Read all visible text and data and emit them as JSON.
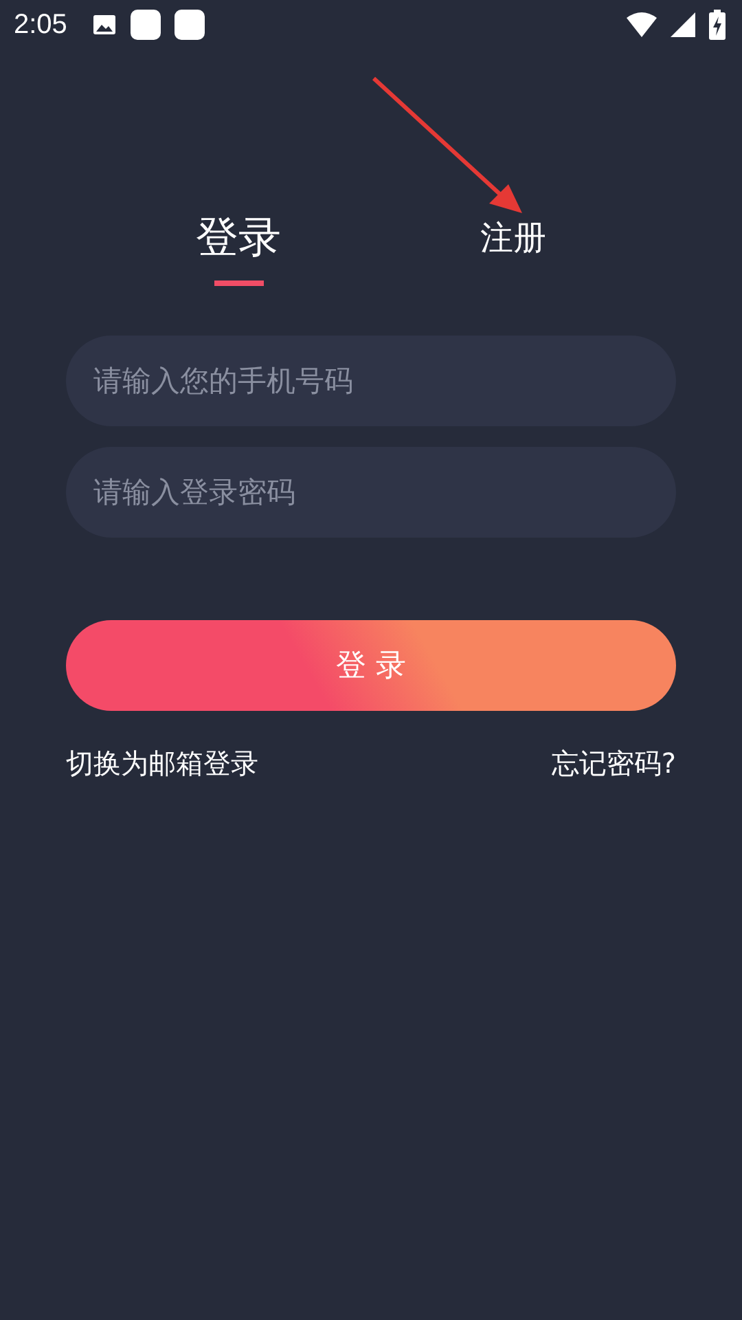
{
  "status_bar": {
    "time": "2:05"
  },
  "tabs": [
    {
      "label": "登录",
      "selected": true
    },
    {
      "label": "注册",
      "selected": false
    }
  ],
  "fields": [
    {
      "placeholder": "请输入您的手机号码"
    },
    {
      "placeholder": "请输入登录密码"
    }
  ],
  "submit_button": "登 录",
  "links": [
    "切换为邮箱登录",
    "忘记密码?"
  ]
}
